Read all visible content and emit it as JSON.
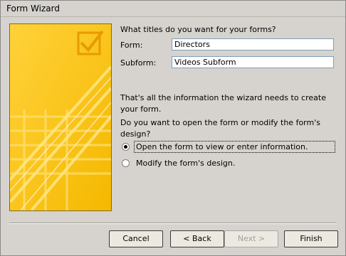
{
  "window": {
    "title": "Form Wizard"
  },
  "prompt": "What titles do you want for your forms?",
  "form_field": {
    "label": "Form:",
    "value": "Directors"
  },
  "subform_field": {
    "label": "Subform:",
    "value": "Videos Subform"
  },
  "info_line1": "That's all the information the wizard needs to create your form.",
  "info_line2": "Do you want to open the form or modify the form's design?",
  "options": [
    {
      "label": "Open the form to view or enter information.",
      "selected": true
    },
    {
      "label": "Modify the form's design.",
      "selected": false
    }
  ],
  "buttons": {
    "cancel": "Cancel",
    "back": "< Back",
    "next": "Next >",
    "finish": "Finish"
  },
  "colors": {
    "illus_bg": "#f7c51a",
    "accent": "#ffe36e"
  }
}
